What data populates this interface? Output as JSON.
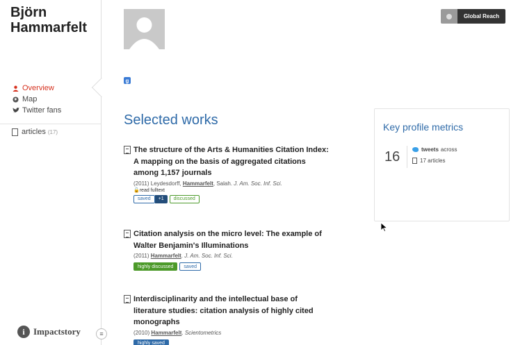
{
  "profile": {
    "name": "Björn Hammarfelt"
  },
  "sidebar": {
    "items": [
      {
        "label": "Overview",
        "icon": "user-icon"
      },
      {
        "label": "Map",
        "icon": "globe-icon"
      },
      {
        "label": "Twitter fans",
        "icon": "twitter-icon"
      }
    ],
    "articles": {
      "label": "articles",
      "count": "(17)"
    }
  },
  "brand": {
    "name": "Impactstory"
  },
  "header": {
    "global_reach": "Global Reach"
  },
  "section": {
    "title": "Selected works"
  },
  "works": [
    {
      "title": "The structure of the Arts & Humanities Citation Index: A mapping on the basis of aggregated citations among 1,157 journals",
      "meta_prefix": "(2011) Leydesdorff, ",
      "author": "Hammarfelt",
      "meta_suffix": ", Salah. ",
      "venue": "J. Am. Soc. Inf. Sci.",
      "fulltext": "read fulltext",
      "badges": [
        "saved",
        "+1",
        "discussed"
      ]
    },
    {
      "title": "Citation analysis on the micro level: The example of Walter Benjamin's Illuminations",
      "meta_prefix": "(2011) ",
      "author": "Hammarfelt",
      "meta_suffix": ". ",
      "venue": "J. Am. Soc. Inf. Sci.",
      "badges": [
        "highly discussed",
        "saved"
      ]
    },
    {
      "title": "Interdisciplinarity and the intellectual base of literature studies: citation analysis of highly cited monographs",
      "meta_prefix": "(2010) ",
      "author": "Hammarfelt",
      "meta_suffix": ". ",
      "venue": "Scientometrics",
      "badges": [
        "highly saved"
      ]
    }
  ],
  "metrics": {
    "title": "Key profile metrics",
    "number": "16",
    "tweets_label": "tweets",
    "tweets_suffix": "across",
    "articles_label": "17 articles"
  },
  "colors": {
    "accent": "#2e6aa8",
    "active": "#d6311e",
    "green": "#4c9a2a"
  }
}
